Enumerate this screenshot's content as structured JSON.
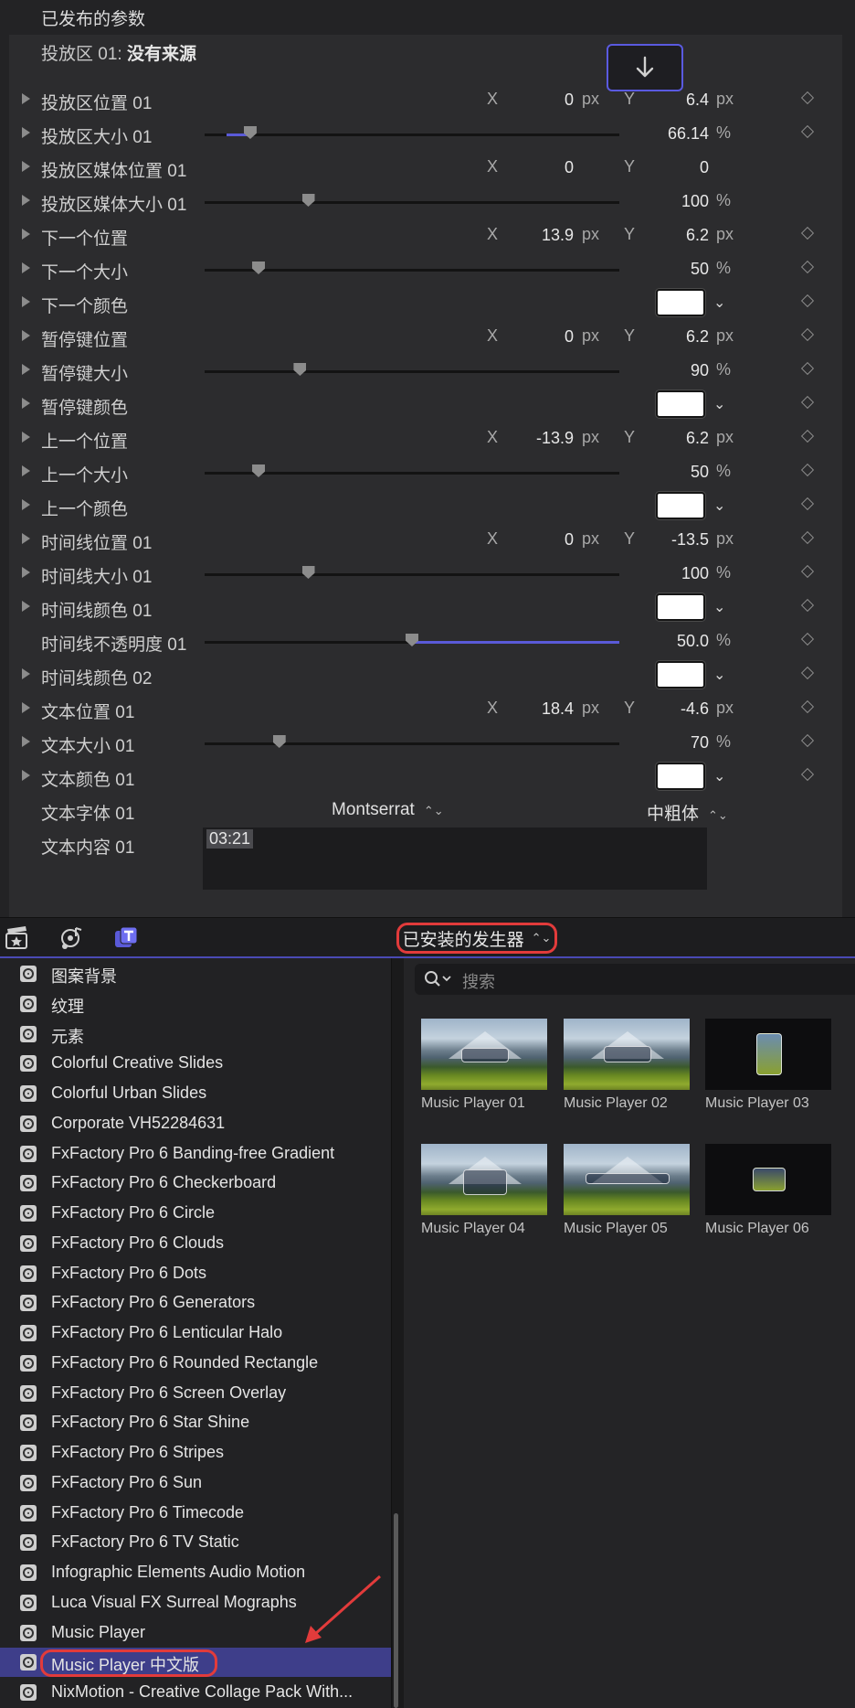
{
  "inspector": {
    "section_title": "已发布的参数",
    "drop_zone_label": "投放区 01:",
    "drop_zone_value": "没有来源",
    "rows": [
      {
        "type": "xy",
        "label": "投放区位置 01",
        "disclosure": true,
        "x": "0",
        "x_unit": "px",
        "y": "6.4",
        "y_unit": "px",
        "keyframe": true
      },
      {
        "type": "slider",
        "label": "投放区大小 01",
        "disclosure": true,
        "value": "66.14",
        "unit": "%",
        "fill": 0.11,
        "keyframe": true
      },
      {
        "type": "xy",
        "label": "投放区媒体位置 01",
        "disclosure": true,
        "x": "0",
        "x_unit": "",
        "y": "0",
        "y_unit": "",
        "keyframe": false
      },
      {
        "type": "slider",
        "label": "投放区媒体大小 01",
        "disclosure": true,
        "value": "100",
        "unit": "%",
        "fill": 0.25,
        "keyframe": false
      },
      {
        "type": "xy",
        "label": "下一个位置",
        "disclosure": true,
        "x": "13.9",
        "x_unit": "px",
        "y": "6.2",
        "y_unit": "px",
        "keyframe": true
      },
      {
        "type": "slider",
        "label": "下一个大小",
        "disclosure": true,
        "value": "50",
        "unit": "%",
        "fill": 0.13,
        "keyframe": true
      },
      {
        "type": "color",
        "label": "下一个颜色",
        "disclosure": true,
        "color": "#ffffff",
        "keyframe": true
      },
      {
        "type": "xy",
        "label": "暂停键位置",
        "disclosure": true,
        "x": "0",
        "x_unit": "px",
        "y": "6.2",
        "y_unit": "px",
        "keyframe": true
      },
      {
        "type": "slider",
        "label": "暂停键大小",
        "disclosure": true,
        "value": "90",
        "unit": "%",
        "fill": 0.23,
        "keyframe": true
      },
      {
        "type": "color",
        "label": "暂停键颜色",
        "disclosure": true,
        "color": "#ffffff",
        "keyframe": true
      },
      {
        "type": "xy",
        "label": "上一个位置",
        "disclosure": true,
        "x": "-13.9",
        "x_unit": "px",
        "y": "6.2",
        "y_unit": "px",
        "keyframe": true
      },
      {
        "type": "slider",
        "label": "上一个大小",
        "disclosure": true,
        "value": "50",
        "unit": "%",
        "fill": 0.13,
        "keyframe": true
      },
      {
        "type": "color",
        "label": "上一个颜色",
        "disclosure": true,
        "color": "#ffffff",
        "keyframe": true
      },
      {
        "type": "xy",
        "label": "时间线位置 01",
        "disclosure": true,
        "x": "0",
        "x_unit": "px",
        "y": "-13.5",
        "y_unit": "px",
        "keyframe": true
      },
      {
        "type": "slider",
        "label": "时间线大小 01",
        "disclosure": true,
        "value": "100",
        "unit": "%",
        "fill": 0.25,
        "keyframe": true
      },
      {
        "type": "color",
        "label": "时间线颜色 01",
        "disclosure": true,
        "color": "#ffffff",
        "keyframe": true
      },
      {
        "type": "slider-right",
        "label": "时间线不透明度 01",
        "disclosure": false,
        "value": "50.0",
        "unit": "%",
        "fill": 0.5,
        "keyframe": true
      },
      {
        "type": "color",
        "label": "时间线颜色 02",
        "disclosure": true,
        "color": "#ffffff",
        "keyframe": true
      },
      {
        "type": "xy",
        "label": "文本位置 01",
        "disclosure": true,
        "x": "18.4",
        "x_unit": "px",
        "y": "-4.6",
        "y_unit": "px",
        "keyframe": true
      },
      {
        "type": "slider",
        "label": "文本大小 01",
        "disclosure": true,
        "value": "70",
        "unit": "%",
        "fill": 0.18,
        "keyframe": true
      },
      {
        "type": "color",
        "label": "文本颜色 01",
        "disclosure": true,
        "color": "#ffffff",
        "keyframe": true
      },
      {
        "type": "font",
        "label": "文本字体 01",
        "disclosure": false,
        "family": "Montserrat",
        "weight": "中粗体"
      },
      {
        "type": "text",
        "label": "文本内容 01",
        "disclosure": false,
        "value": "03:21"
      }
    ]
  },
  "axis_labels": {
    "x": "X",
    "y": "Y"
  },
  "toolbar": {
    "generator_menu": "已安装的发生器"
  },
  "sidebar": {
    "items": [
      "图案背景",
      "纹理",
      "元素",
      "Colorful Creative Slides",
      "Colorful Urban Slides",
      "Corporate VH52284631",
      "FxFactory Pro 6 Banding-free Gradient",
      "FxFactory Pro 6 Checkerboard",
      "FxFactory Pro 6 Circle",
      "FxFactory Pro 6 Clouds",
      "FxFactory Pro 6 Dots",
      "FxFactory Pro 6 Generators",
      "FxFactory Pro 6 Lenticular Halo",
      "FxFactory Pro 6 Rounded Rectangle",
      "FxFactory Pro 6 Screen Overlay",
      "FxFactory Pro 6 Star Shine",
      "FxFactory Pro 6 Stripes",
      "FxFactory Pro 6 Sun",
      "FxFactory Pro 6 Timecode",
      "FxFactory Pro 6 TV Static",
      "Infographic Elements Audio Motion",
      "Luca Visual FX Surreal Mographs",
      "Music Player",
      "Music Player 中文版",
      "NixMotion - Creative Collage Pack With..."
    ],
    "selected": "Music Player 中文版"
  },
  "browser": {
    "search_placeholder": "搜索",
    "thumbnails": [
      {
        "name": "Music Player 01",
        "style": "landscape"
      },
      {
        "name": "Music Player 02",
        "style": "landscape"
      },
      {
        "name": "Music Player 03",
        "style": "dark"
      },
      {
        "name": "Music Player 04",
        "style": "landscape"
      },
      {
        "name": "Music Player 05",
        "style": "landscape"
      },
      {
        "name": "Music Player 06",
        "style": "dark"
      }
    ]
  },
  "colors": {
    "accent": "#5a5ad8",
    "highlight": "#e23b3b",
    "selection": "#3e3e8a"
  }
}
